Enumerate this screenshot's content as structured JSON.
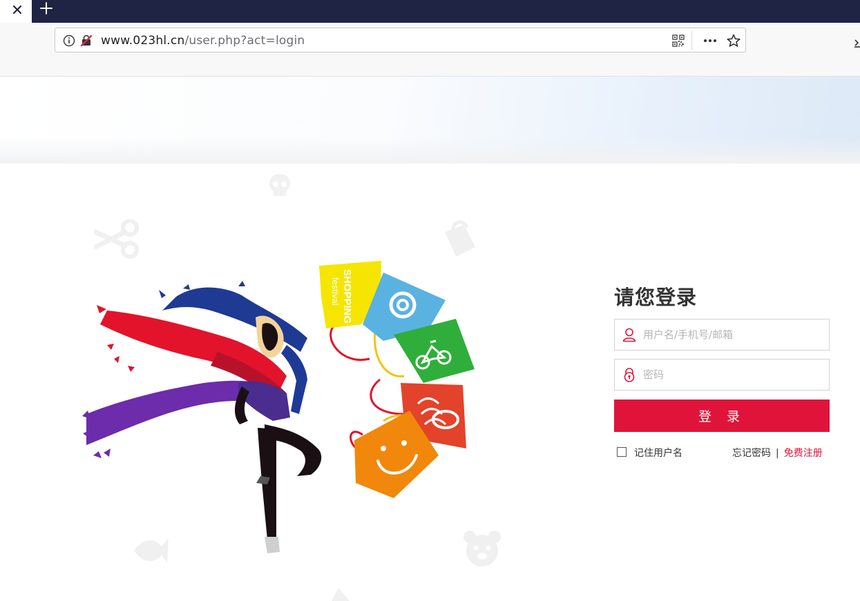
{
  "browser": {
    "url_domain": "www.023hl.cn",
    "url_path": "/user.php?act=login"
  },
  "login": {
    "title": "请您登录",
    "username_placeholder": "用户名/手机号/邮箱",
    "password_placeholder": "密码",
    "submit_label": "登 录",
    "remember_label": "记住用户名",
    "forgot_label": "忘记密码",
    "separator": "|",
    "register_label": "免费注册"
  },
  "hero": {
    "bag_text_1": "SHOPPING",
    "bag_text_2": "festival"
  },
  "colors": {
    "accent": "#e0143a",
    "tabbar": "#1f2344"
  }
}
